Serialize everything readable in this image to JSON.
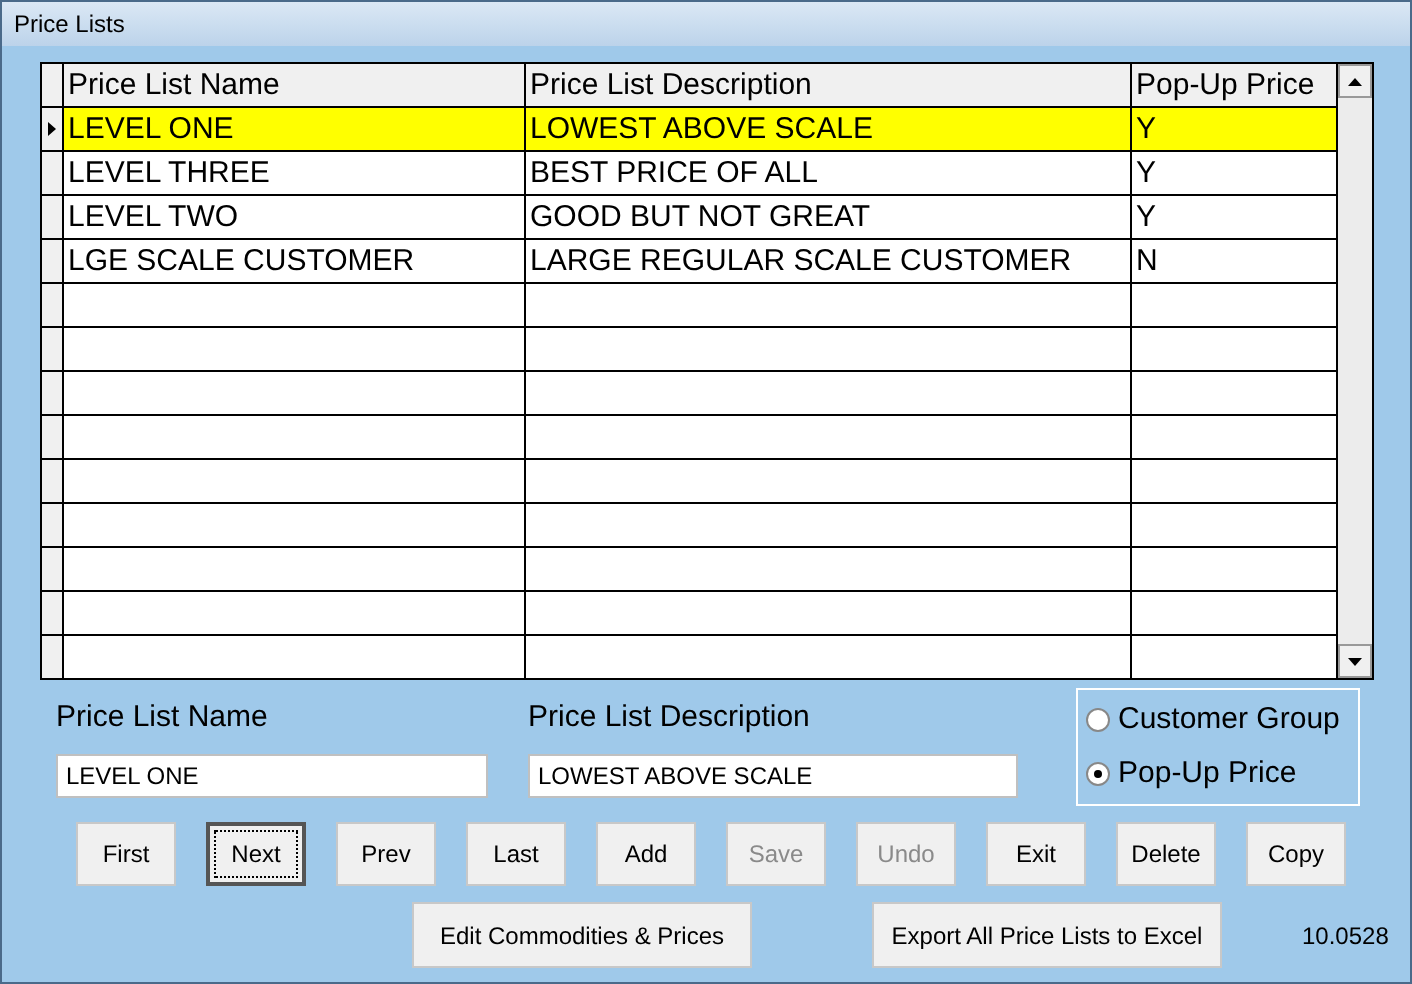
{
  "window": {
    "title": "Price Lists"
  },
  "table": {
    "columns": [
      "Price List Name",
      "Price List Description",
      "Pop-Up Price"
    ],
    "rows": [
      {
        "cells": [
          "LEVEL ONE",
          "LOWEST ABOVE SCALE",
          "Y"
        ],
        "selected": true
      },
      {
        "cells": [
          "LEVEL THREE",
          "BEST PRICE OF ALL",
          "Y"
        ],
        "selected": false
      },
      {
        "cells": [
          "LEVEL TWO",
          "GOOD BUT NOT GREAT",
          "Y"
        ],
        "selected": false
      },
      {
        "cells": [
          "LGE SCALE CUSTOMER",
          "LARGE REGULAR SCALE CUSTOMER",
          "N"
        ],
        "selected": false
      }
    ]
  },
  "fields": [
    {
      "label": "Price List Name",
      "value": "LEVEL ONE"
    },
    {
      "label": "Price List Description",
      "value": "LOWEST ABOVE SCALE"
    }
  ],
  "options": [
    {
      "label": "Customer Group",
      "selected": false
    },
    {
      "label": "Pop-Up Price",
      "selected": true
    }
  ],
  "buttons": [
    {
      "label": "First",
      "disabled": false,
      "focused": false
    },
    {
      "label": "Next",
      "disabled": false,
      "focused": true
    },
    {
      "label": "Prev",
      "disabled": false,
      "focused": false
    },
    {
      "label": "Last",
      "disabled": false,
      "focused": false
    },
    {
      "label": "Add",
      "disabled": false,
      "focused": false
    },
    {
      "label": "Save",
      "disabled": true,
      "focused": false
    },
    {
      "label": "Undo",
      "disabled": true,
      "focused": false
    },
    {
      "label": "Exit",
      "disabled": false,
      "focused": false
    },
    {
      "label": "Delete",
      "disabled": false,
      "focused": false
    },
    {
      "label": "Copy",
      "disabled": false,
      "focused": false
    }
  ],
  "wide_buttons": [
    "Edit Commodities & Prices",
    "Export All Price Lists to Excel"
  ],
  "version": "10.0528"
}
